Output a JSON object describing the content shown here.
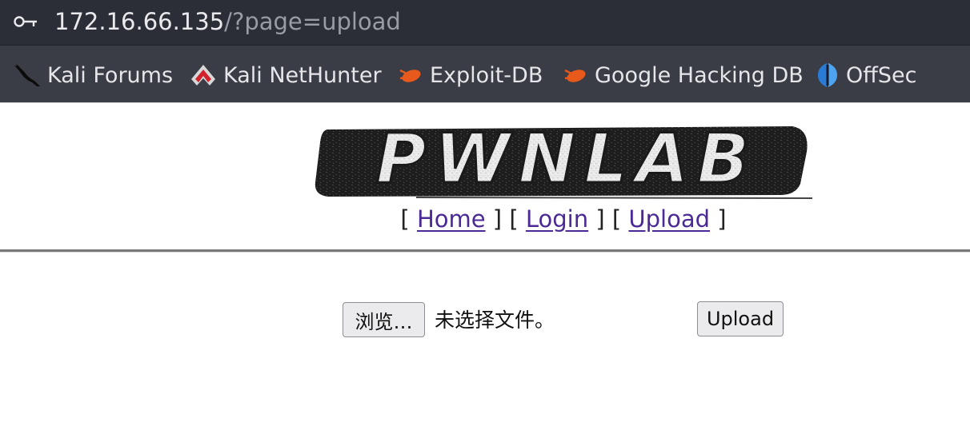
{
  "address_bar": {
    "host": "172.16.66.135",
    "path": "/?page=upload"
  },
  "bookmarks": [
    {
      "label": "Kali Forums",
      "icon": "kali-dragon-icon"
    },
    {
      "label": "Kali NetHunter",
      "icon": "nethunter-icon"
    },
    {
      "label": "Exploit-DB",
      "icon": "exploitdb-bug-icon"
    },
    {
      "label": "Google Hacking DB",
      "icon": "exploitdb-bug-icon"
    },
    {
      "label": "OffSec",
      "icon": "offsec-icon"
    }
  ],
  "logo": {
    "text": "PWNLAB"
  },
  "nav": {
    "bracket_open": "[",
    "bracket_mid": "] [",
    "bracket_close": "]",
    "home": "Home",
    "login": "Login",
    "upload": "Upload"
  },
  "upload_form": {
    "browse_label": "浏览…",
    "file_status": "未选择文件。",
    "submit_label": "Upload"
  },
  "colors": {
    "urlbar_bg": "#2b2e36",
    "bookmarks_bg": "#3a3d45",
    "link": "#4b2a96"
  }
}
